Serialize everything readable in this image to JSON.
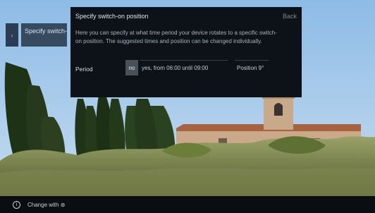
{
  "left_nav": {
    "back_glyph": "‹"
  },
  "nav_item": {
    "label": "Specify switch-on po"
  },
  "dialog": {
    "title": "Specify switch-on position",
    "back_label": "Back",
    "description": "Here you can specify at what time period your device rotates to a specific switch-on position. The suggested times and position can be changed individually.",
    "period_label": "Period",
    "options": {
      "no": "no",
      "yes": "yes, from  06:00   until  09:00",
      "position": "Position 9°"
    }
  },
  "footer": {
    "info_glyph": "i",
    "hint": "Change with ⊛"
  },
  "colors": {
    "sky": "#7fb0de",
    "dialog_bg": "#0c1218",
    "nav_item_bg": "#2e4054",
    "selected_option_bg": "#4a5057"
  }
}
